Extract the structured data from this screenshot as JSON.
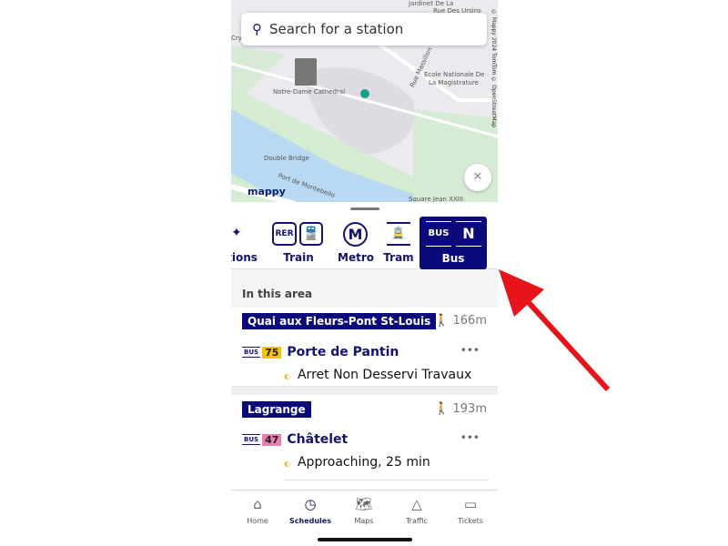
{
  "search": {
    "placeholder": "Search for a station",
    "icon": "search-icon"
  },
  "map": {
    "labels": {
      "jardinet": "Jardinet De La",
      "rue_ursins": "Rue Des Ursins",
      "notre_dame": "Notre-Dame Cathedral",
      "ecole1": "Ecole Nationale De",
      "ecole2": "La Magistrature",
      "rue_massillon": "Rue Massillon",
      "double_bridge": "Double Bridge",
      "square": "Square Jean XXIII",
      "port": "Port de Montebello",
      "cry": "Cryp"
    },
    "attribution": "© Mappy 2024 TomTom © OpenStreetMap",
    "logo": "mappy",
    "location_color": "#1a9e85"
  },
  "transit_tabs": [
    {
      "label": "tions",
      "icon": "star-icon"
    },
    {
      "label": "Train",
      "icons": [
        "RER",
        "train-icon"
      ]
    },
    {
      "label": "Metro",
      "icon": "M"
    },
    {
      "label": "Tram",
      "icon": "tram-icon"
    },
    {
      "label": "Bus",
      "icons": [
        "BUS",
        "N"
      ],
      "selected": true
    }
  ],
  "section_title": "In this area",
  "stops": [
    {
      "name": "Quai aux Fleurs-Pont St-Louis",
      "distance": "166m",
      "lines": [
        {
          "mode": "BUS",
          "number": "75",
          "number_color": "#f5c400",
          "destination": "Porte de Pantin",
          "status": "Arret Non Desservi Travaux",
          "more": "•••"
        }
      ]
    },
    {
      "name": "Lagrange",
      "distance": "193m",
      "lines": [
        {
          "mode": "BUS",
          "number": "47",
          "number_color": "#e97fb0",
          "destination": "Châtelet",
          "status": "Approaching, 25 min",
          "more": "•••"
        }
      ]
    }
  ],
  "nav": [
    {
      "label": "Home"
    },
    {
      "label": "Schedules",
      "active": true
    },
    {
      "label": "Maps"
    },
    {
      "label": "Traffic"
    },
    {
      "label": "Tickets"
    }
  ],
  "colors": {
    "brand": "#0a0a7a",
    "arrow": "#e8141b"
  }
}
